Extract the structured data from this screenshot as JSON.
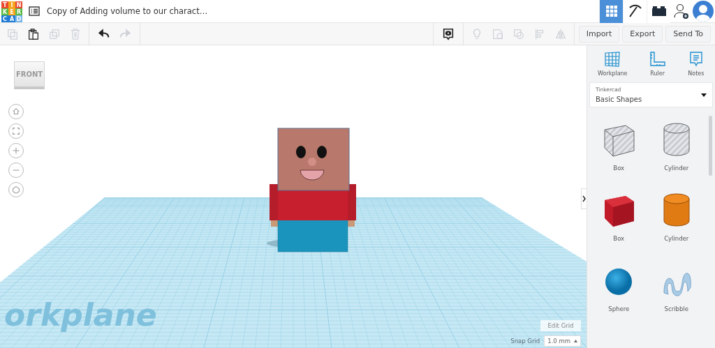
{
  "app": {
    "logo_letters": [
      "T",
      "I",
      "N",
      "K",
      "E",
      "R",
      "C",
      "A",
      "D"
    ],
    "title": "Copy of Adding volume to our charact…",
    "views": [
      {
        "kind": "grid",
        "selected": true
      },
      {
        "kind": "pickaxe",
        "selected": false
      },
      {
        "kind": "brick",
        "selected": false
      }
    ]
  },
  "toolbar": {
    "tools": [
      {
        "kind": "copy",
        "disabled": true
      },
      {
        "kind": "paste",
        "disabled": false
      },
      {
        "kind": "duplicate",
        "disabled": true
      },
      {
        "kind": "delete",
        "disabled": true
      },
      {
        "kind": "undo",
        "disabled": false
      },
      {
        "kind": "redo",
        "disabled": true
      }
    ],
    "view_tools": [
      {
        "kind": "note",
        "disabled": false
      },
      {
        "kind": "bulb",
        "disabled": true
      },
      {
        "kind": "shape",
        "disabled": true
      },
      {
        "kind": "hole",
        "disabled": true
      },
      {
        "kind": "align",
        "disabled": true
      },
      {
        "kind": "mirror",
        "disabled": true
      }
    ],
    "actions": [
      "Import",
      "Export",
      "Send To"
    ]
  },
  "viewport": {
    "view_cube": "FRONT",
    "workplane_label": "orkplane",
    "edit_grid": "Edit Grid",
    "snap_grid_label": "Snap Grid",
    "snap_grid_value": "1.0 mm"
  },
  "panel": {
    "tools": [
      {
        "kind": "workplane",
        "label": "Workplane"
      },
      {
        "kind": "ruler",
        "label": "Ruler"
      },
      {
        "kind": "notes",
        "label": "Notes"
      }
    ],
    "library": {
      "provider": "Tinkercad",
      "name": "Basic Shapes"
    },
    "shapes": [
      {
        "kind": "box-hole",
        "name": "Box"
      },
      {
        "kind": "cylinder-hole",
        "name": "Cylinder"
      },
      {
        "kind": "box",
        "name": "Box"
      },
      {
        "kind": "cylinder",
        "name": "Cylinder"
      },
      {
        "kind": "sphere",
        "name": "Sphere"
      },
      {
        "kind": "scribble",
        "name": "Scribble"
      }
    ]
  }
}
